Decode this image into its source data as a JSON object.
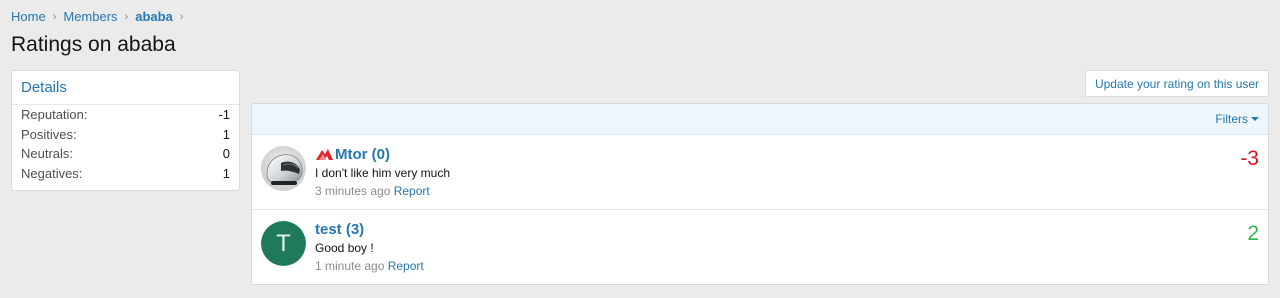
{
  "breadcrumb": {
    "items": [
      {
        "label": "Home"
      },
      {
        "label": "Members"
      },
      {
        "label": "ababa"
      }
    ]
  },
  "page": {
    "title": "Ratings on ababa"
  },
  "details": {
    "title": "Details",
    "stats": [
      {
        "label": "Reputation:",
        "value": "-1"
      },
      {
        "label": "Positives:",
        "value": "1"
      },
      {
        "label": "Neutrals:",
        "value": "0"
      },
      {
        "label": "Negatives:",
        "value": "1"
      }
    ]
  },
  "actions": {
    "update_rating_label": "Update your rating on this user"
  },
  "filters": {
    "label": "Filters"
  },
  "ratings": [
    {
      "username": "Mtor (0)",
      "message": "I don't like him very much",
      "time": "3 minutes ago",
      "report_label": "Report",
      "score": "-3",
      "avatar_icon": "motorcycle-helmet-avatar",
      "user_icon": "red-brand-logo-icon"
    },
    {
      "username": "test (3)",
      "message": "Good boy !",
      "time": "1 minute ago",
      "report_label": "Report",
      "score": "2",
      "avatar_letter": "T"
    }
  ],
  "colors": {
    "link": "#2577b1",
    "negative": "#d8141f",
    "positive": "#31b544",
    "avatar_bg": "#1e7a5a"
  }
}
